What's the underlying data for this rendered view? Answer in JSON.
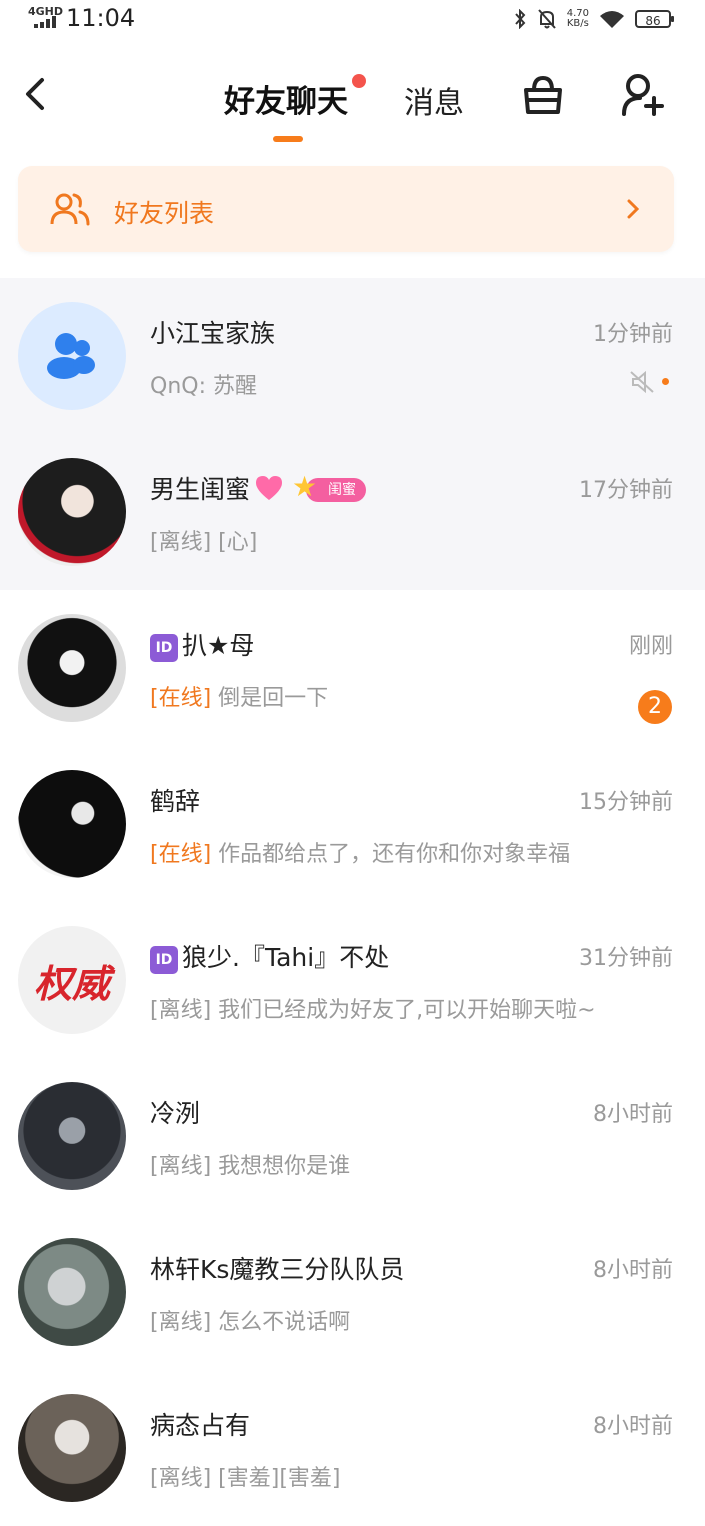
{
  "status_bar": {
    "network": "4GHD",
    "time": "11:04",
    "speed_value": "4.70",
    "speed_unit": "KB/s",
    "battery": "86"
  },
  "header": {
    "active_tab": "好友聊天",
    "other_tab": "消息"
  },
  "friends_card": {
    "label": "好友列表"
  },
  "colors": {
    "accent": "#f77c1b",
    "card_bg": "#fff1e6",
    "badge_red": "#f4544c",
    "muted_text": "#9a9a9a"
  },
  "chats": [
    {
      "name": "小江宝家族",
      "time": "1分钟前",
      "status": "",
      "message": "QnQ: 苏醒",
      "icon": "group-icon",
      "muted": true
    },
    {
      "name": "男生闺蜜",
      "time": "17分钟前",
      "status": "[离线]",
      "message": "[心]",
      "tag": "闺蜜"
    },
    {
      "name": "扒★母",
      "time": "刚刚",
      "status": "[在线]",
      "message": "倒是回一下",
      "unread": "2",
      "id_badge": "ID"
    },
    {
      "name": "鹤辞",
      "time": "15分钟前",
      "status": "[在线]",
      "message": "作品都给点了，还有你和你对象幸福"
    },
    {
      "name": "狼少.『Tahi』不处",
      "time": "31分钟前",
      "status": "[离线]",
      "message": "我们已经成为好友了,可以开始聊天啦~",
      "id_badge": "ID",
      "avatar_text": "权威"
    },
    {
      "name": "冷洌",
      "time": "8小时前",
      "status": "[离线]",
      "message": "我想想你是谁"
    },
    {
      "name": "林轩Ks魔教三分队队员",
      "time": "8小时前",
      "status": "[离线]",
      "message": "怎么不说话啊"
    },
    {
      "name": "病态占有",
      "time": "8小时前",
      "status": "[离线]",
      "message": "[害羞][害羞]"
    }
  ]
}
